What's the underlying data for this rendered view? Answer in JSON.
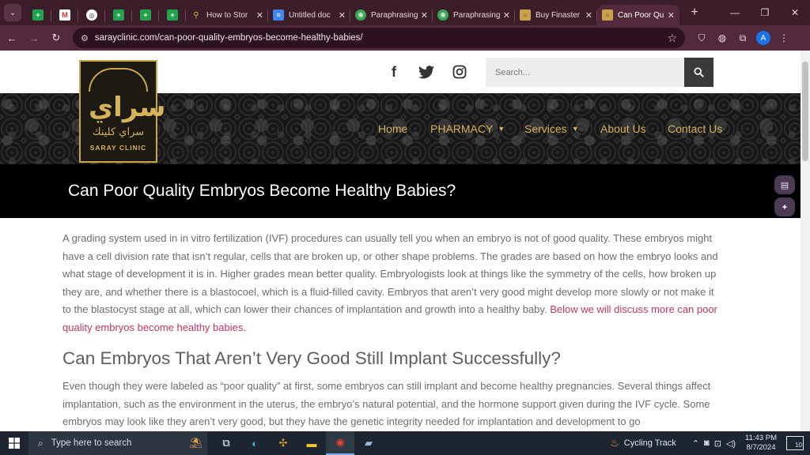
{
  "browser": {
    "tabs": [
      {
        "label": "",
        "icon": "sheet-icon",
        "favicon": "green"
      },
      {
        "label": "",
        "icon": "gmail-icon",
        "favicon": "gmail"
      },
      {
        "label": "",
        "icon": "circle-icon",
        "favicon": "circle"
      },
      {
        "label": "",
        "icon": "sheet-icon",
        "favicon": "green"
      },
      {
        "label": "",
        "icon": "sheet-icon",
        "favicon": "green"
      },
      {
        "label": "",
        "icon": "sheet-icon",
        "favicon": "green"
      },
      {
        "label": "How to Stor",
        "icon": "pin-icon",
        "favicon": "pin"
      },
      {
        "label": "Untitled doc",
        "icon": "docs-icon",
        "favicon": "docs"
      },
      {
        "label": "Paraphrasing",
        "icon": "paraphrase-icon",
        "favicon": "para"
      },
      {
        "label": "Paraphrasing",
        "icon": "paraphrase-icon",
        "favicon": "para"
      },
      {
        "label": "Buy Finaster",
        "icon": "saray-icon",
        "favicon": "saray"
      },
      {
        "label": "Can Poor Qu",
        "icon": "saray-icon",
        "favicon": "saray",
        "active": true
      }
    ],
    "url": "sarayclinic.com/can-poor-quality-embryos-become-healthy-babies/",
    "profile_initial": "A"
  },
  "site": {
    "search_placeholder": "Search...",
    "logo_arabic": "سراي كلينك",
    "logo_latin": "SARAY CLINIC",
    "logo_mark": "سراي",
    "nav": [
      {
        "label": "Home",
        "has_dropdown": false
      },
      {
        "label": "PHARMACY",
        "has_dropdown": true
      },
      {
        "label": "Services",
        "has_dropdown": true
      },
      {
        "label": "About Us",
        "has_dropdown": false
      },
      {
        "label": "Contact Us",
        "has_dropdown": false
      }
    ],
    "social": [
      "facebook-icon",
      "twitter-icon",
      "instagram-icon"
    ],
    "colors": {
      "nav_gold": "#d8b15a",
      "link": "#c13567",
      "title_bar": "#000000"
    }
  },
  "article": {
    "title": "Can Poor Quality Embryos Become Healthy Babies?",
    "p1": "A grading system used in in vitro fertilization (IVF) procedures can usually tell you when an embryo is not of good quality. These embryos might have a cell division rate that isn’t regular, cells that are broken up, or other shape problems. The grades are based on how the embryo looks and what stage of development it is in. Higher grades mean better quality. Embryologists look at things like the symmetry of the cells, how broken up they are, and whether there is a blastocoel, which is a fluid-filled cavity. Embryos that aren’t very good might develop more slowly or not make it to the blastocyst stage at all, which can lower their chances of implantation and growth into a healthy baby.",
    "p1_link": "Below we will discuss more can poor quality embryos become healthy babies.",
    "h2": "Can Embryos That Aren’t Very Good Still Implant Successfully?",
    "p2": "Even though they were labeled as “poor quality” at first, some embryos can still implant and become healthy pregnancies. Several things affect implantation, such as the environment in the uterus, the embryo’s natural potential, and the hormone support given during the IVF cycle. Some embryos may look like they aren’t very good, but they have the genetic integrity needed for implantation and development to go"
  },
  "taskbar": {
    "search_placeholder": "Type here to search",
    "weather_label": "Cycling Track",
    "time": "11:43 PM",
    "date": "8/7/2024",
    "notifications": "10"
  }
}
